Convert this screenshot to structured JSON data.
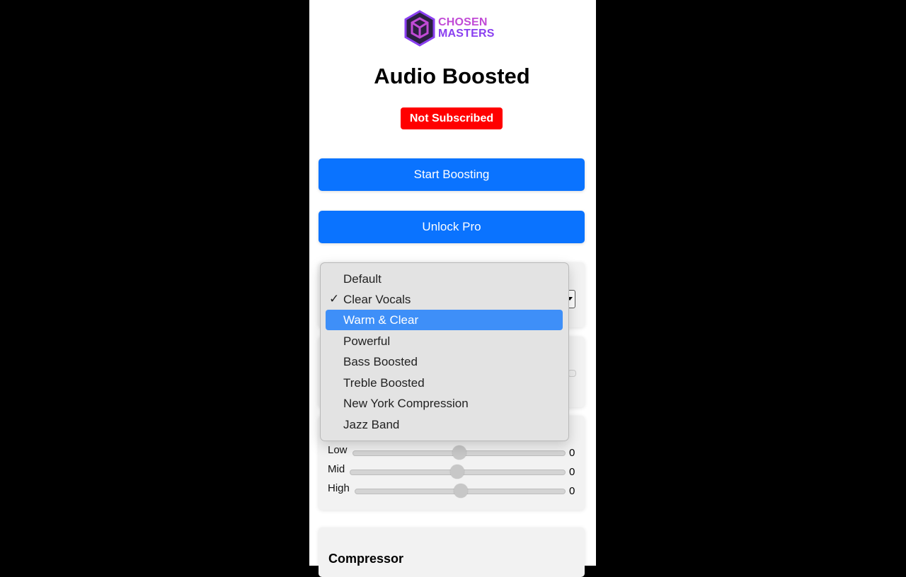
{
  "brand": {
    "logo_line1": "CHOSEN",
    "logo_line2": "MASTERS",
    "colors": {
      "purple": "#8a3ff0",
      "magenta": "#c14ad6",
      "dark": "#2a2040"
    }
  },
  "header": {
    "title": "Audio Boosted",
    "status_badge": "Not Subscribed"
  },
  "actions": {
    "start_label": "Start Boosting",
    "unlock_label": "Unlock Pro"
  },
  "preset_dropdown": {
    "selected": "Clear Vocals",
    "highlighted": "Warm & Clear",
    "options": [
      "Default",
      "Clear Vocals",
      "Warm & Clear",
      "Powerful",
      "Bass Boosted",
      "Treble Boosted",
      "New York Compression",
      "Jazz Band"
    ]
  },
  "equalizer": {
    "bands": [
      {
        "label": "Low",
        "value": "0"
      },
      {
        "label": "Mid",
        "value": "0"
      },
      {
        "label": "High",
        "value": "0"
      }
    ]
  },
  "compressor": {
    "title": "Compressor"
  },
  "colors": {
    "accent": "#0a73ff",
    "badge": "#ff0000",
    "highlight": "#3e8ff8"
  }
}
